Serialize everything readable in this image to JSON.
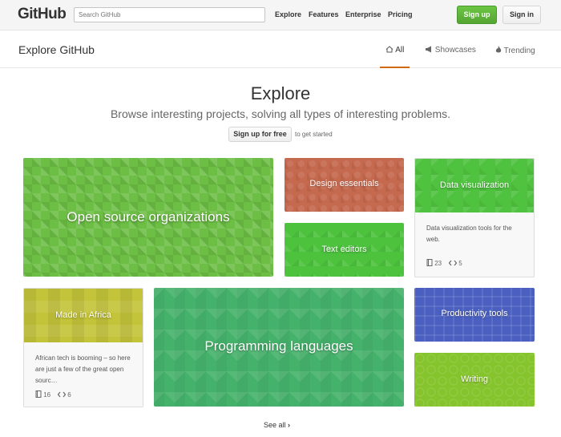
{
  "header": {
    "logo": "GitHub",
    "search_placeholder": "Search GitHub",
    "nav": [
      "Explore",
      "Features",
      "Enterprise",
      "Pricing"
    ],
    "signup": "Sign up",
    "signin": "Sign in"
  },
  "subheader": {
    "title": "Explore GitHub",
    "tabs": [
      {
        "label": "All",
        "icon": "home-icon",
        "active": true
      },
      {
        "label": "Showcases",
        "icon": "megaphone-icon",
        "active": false
      },
      {
        "label": "Trending",
        "icon": "flame-icon",
        "active": false
      }
    ]
  },
  "hero": {
    "title": "Explore",
    "subtitle": "Browse interesting projects, solving all types of interesting problems.",
    "signup_free": "Sign up for free",
    "get_started": "to get started"
  },
  "cards": {
    "open_source": {
      "label": "Open source organizations",
      "color": "#6cbe45"
    },
    "design": {
      "label": "Design essentials",
      "color": "#c5694f"
    },
    "text_editors": {
      "label": "Text editors",
      "color": "#4cc23d"
    },
    "data_viz": {
      "label": "Data visualization",
      "color": "#4fc23f",
      "description": "Data visualization tools for the web.",
      "repos": "23",
      "code": "5"
    },
    "africa": {
      "label": "Made in Africa",
      "color": "#c4c43a",
      "description": "African tech is booming – so here are just a few of the great open sourc…",
      "repos": "16",
      "code": "6"
    },
    "languages": {
      "label": "Programming languages",
      "color": "#45b26b"
    },
    "productivity": {
      "label": "Productivity tools",
      "color": "#4a5fbf"
    },
    "writing": {
      "label": "Writing",
      "color": "#86c42e"
    }
  },
  "footer": {
    "see_all": "See all"
  }
}
